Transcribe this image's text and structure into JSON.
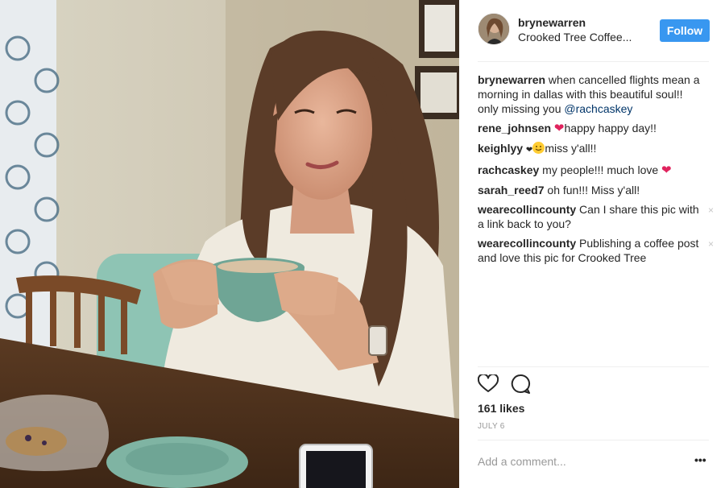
{
  "post": {
    "username": "brynewarren",
    "location": "Crooked Tree Coffee...",
    "follow_label": "Follow",
    "likes": "161 likes",
    "date": "JULY 6",
    "add_comment_placeholder": "Add a comment...",
    "more_label": "•••"
  },
  "caption": {
    "user": "brynewarren",
    "text": " when cancelled flights mean a morning in dallas with this beautiful soul!! only missing you ",
    "mention": "@rachcaskey"
  },
  "comments": [
    {
      "user": "rene_johnsen",
      "text": "happy happy day!!",
      "emoji": "❤"
    },
    {
      "user": "keighlyy",
      "text": "miss y'all!!",
      "emoji": "❤"
    },
    {
      "user": "rachcaskey",
      "text": " my people!!! much love ",
      "emoji": "❤"
    },
    {
      "user": "sarah_reed7",
      "text": " oh fun!!! Miss y'all!"
    },
    {
      "user": "wearecollincounty",
      "text": " Can I share this pic with a link back to you?",
      "close": "×"
    },
    {
      "user": "wearecollincounty",
      "text": " Publishing a coffee post and love this pic for Crooked Tree",
      "close": "×"
    }
  ],
  "icons": {
    "like": "heart-outline-icon",
    "comment": "speech-bubble-icon",
    "more": "ellipsis-icon"
  },
  "colors": {
    "follow_bg": "#3897f0",
    "mention": "#003569",
    "heart": "#e0245e"
  }
}
